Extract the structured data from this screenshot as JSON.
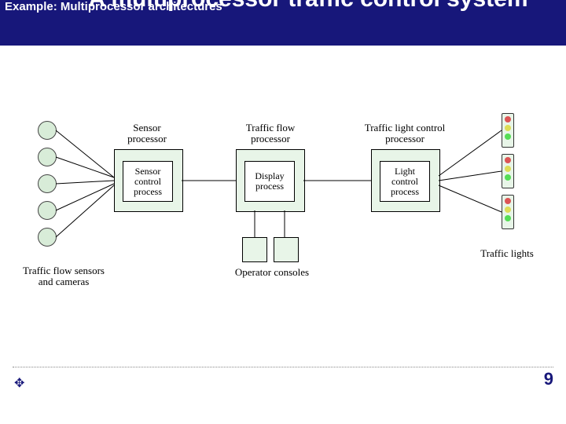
{
  "banner": {
    "subtitle": "Example: Multiprocessor architectures",
    "title": "A multiprocessor traffic control system"
  },
  "labels": {
    "sensor_proc": "Sensor\nprocessor",
    "flow_proc": "Traffic flow\nprocessor",
    "light_proc": "Traffic light control\nprocessor",
    "sensor_inner": "Sensor control process",
    "flow_inner": "Display process",
    "light_inner": "Light control process",
    "sensors": "Traffic flow sensors\nand cameras",
    "consoles": "Operator consoles",
    "lights": "Traffic lights"
  },
  "page_number": "9"
}
